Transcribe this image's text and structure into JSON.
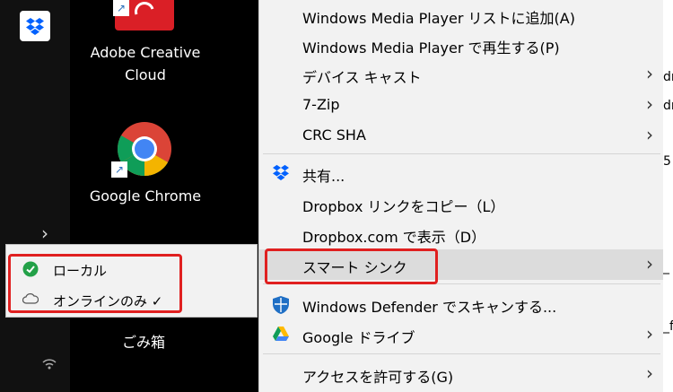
{
  "desktop": {
    "adobe_label": "Adobe Creative Cloud",
    "chrome_label": "Google Chrome",
    "trash_label": "ごみ箱"
  },
  "submenu": {
    "items": [
      {
        "label": "ローカル",
        "icon": "green-check-icon"
      },
      {
        "label": "オンラインのみ ✓",
        "icon": "cloud-icon"
      }
    ]
  },
  "menu": {
    "items": [
      {
        "label": "Windows Media Player リストに追加(A)",
        "arrow": false
      },
      {
        "label": "Windows Media Player で再生する(P)",
        "arrow": false
      },
      {
        "label": "デバイス キャスト",
        "arrow": true
      },
      {
        "label": "7-Zip",
        "arrow": true
      },
      {
        "label": "CRC SHA",
        "arrow": true
      },
      {
        "label": "共有...",
        "arrow": false,
        "icon": "dropbox-icon"
      },
      {
        "label": "Dropbox リンクをコピー（L）",
        "arrow": false
      },
      {
        "label": "Dropbox.com で表示（D）",
        "arrow": false
      },
      {
        "label": "スマート シンク",
        "arrow": true,
        "highlighted": true
      },
      {
        "label": "Windows Defender でスキャンする...",
        "arrow": false,
        "icon": "defender-shield-icon"
      },
      {
        "label": "Google ドライブ",
        "arrow": true,
        "icon": "google-drive-icon"
      },
      {
        "label": "アクセスを許可する(G)",
        "arrow": true
      }
    ],
    "arrow_glyph": "›"
  },
  "right_edge_text": [
    "dr",
    "dr",
    "5",
    "_",
    "_f"
  ],
  "colors": {
    "highlight_box": "#e02020",
    "menu_bg": "#f2f2f2",
    "hover_bg": "#dcdcdc",
    "dropbox": "#0061fe"
  }
}
